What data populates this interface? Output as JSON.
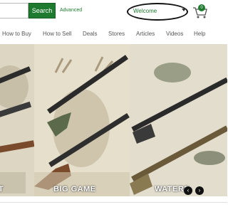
{
  "search": {
    "value": "",
    "placeholder": "",
    "button_label": "Search",
    "advanced_label": "Advanced"
  },
  "account": {
    "welcome_label": "Welcome"
  },
  "cart": {
    "count": "0"
  },
  "nav": {
    "items": [
      {
        "label": "How to Buy"
      },
      {
        "label": "How to Sell"
      },
      {
        "label": "Deals"
      },
      {
        "label": "Stores"
      },
      {
        "label": "Articles"
      },
      {
        "label": "Videos"
      },
      {
        "label": "Help"
      }
    ]
  },
  "hero": {
    "panels": [
      {
        "caption": "T"
      },
      {
        "caption": "BIG GAME"
      },
      {
        "caption": "WATERF"
      }
    ],
    "prev_icon": "chevron-left-icon",
    "next_icon": "chevron-right-icon"
  },
  "colors": {
    "brand_green": "#1e7a2e",
    "panel_bg": "#e8e2d2"
  }
}
